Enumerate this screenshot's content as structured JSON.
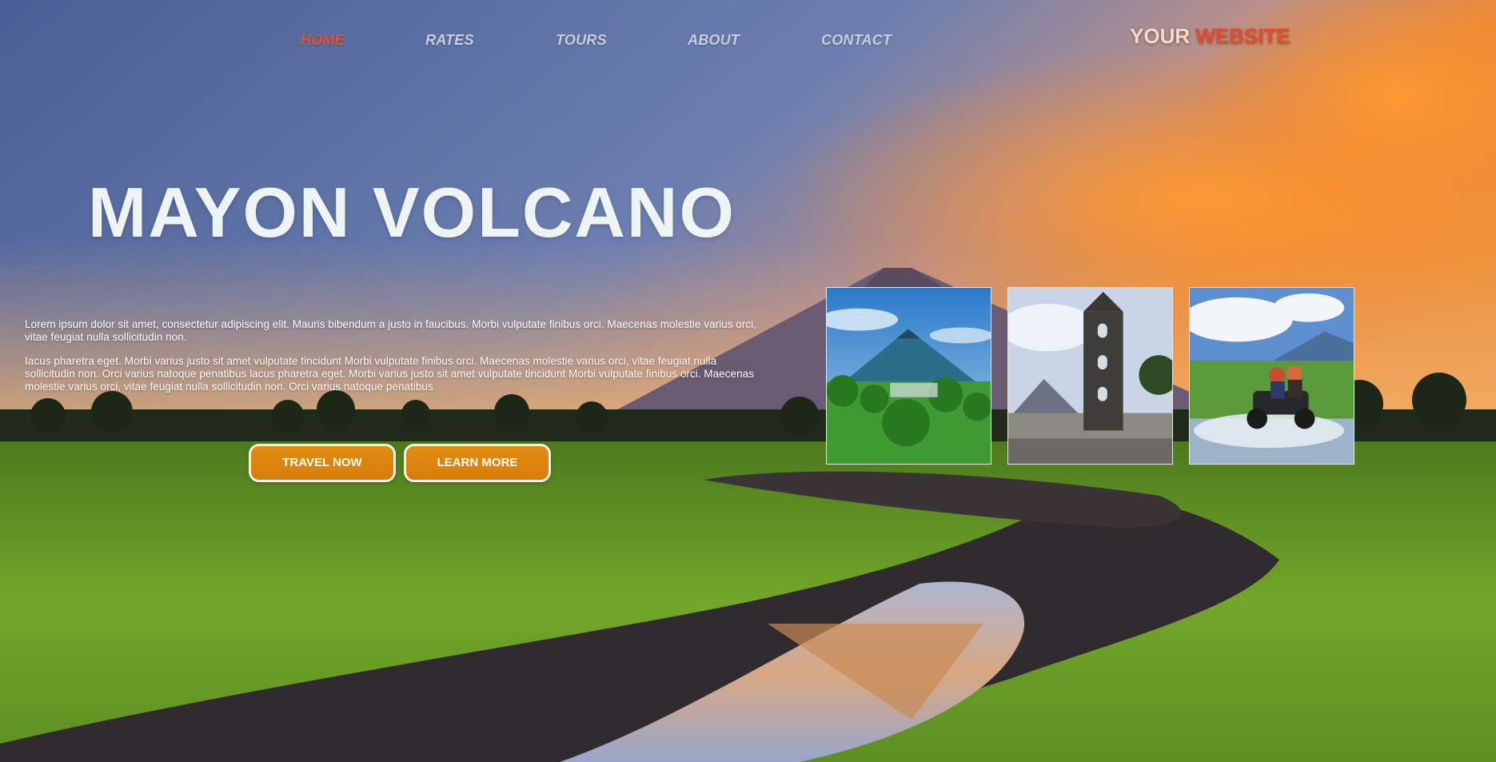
{
  "nav": {
    "items": [
      {
        "label": "HOME",
        "active": true
      },
      {
        "label": "RATES",
        "active": false
      },
      {
        "label": "TOURS",
        "active": false
      },
      {
        "label": "ABOUT",
        "active": false
      },
      {
        "label": "CONTACT",
        "active": false
      }
    ]
  },
  "brand": {
    "part1": "YOUR",
    "part2": "WEBSITE"
  },
  "hero": {
    "title": "MAYON VOLCANO",
    "paragraph1": "Lorem ipsum dolor sit amet, consectetur adipiscing elit. Mauris bibendum a justo in faucibus. Morbi vulputate finibus orci. Maecenas molestie varius orci, vitae feugiat nulla sollicitudin non.",
    "paragraph2": "Iacus pharetra eget. Morbi varius justo sit amet vulputate tincidunt Morbi vulputate finibus orci. Maecenas molestie varius orci, vitae feugiat nulla sollicitudin non. Orci varius natoque penatibus lacus pharetra eget. Morbi varius justo sit amet vulputate tincidunt Morbi vulputate finibus orci. Maecenas molestie varius orci, vitae feugiat nulla sollicitudin non. Orci varius natoque penatibus"
  },
  "buttons": {
    "travel": "TRAVEL NOW",
    "learn": "LEARN MORE"
  },
  "colors": {
    "accent": "#e94a2c",
    "button": "#dd850f",
    "nav": "#c9cde0",
    "nav_active": "#e0533a"
  }
}
